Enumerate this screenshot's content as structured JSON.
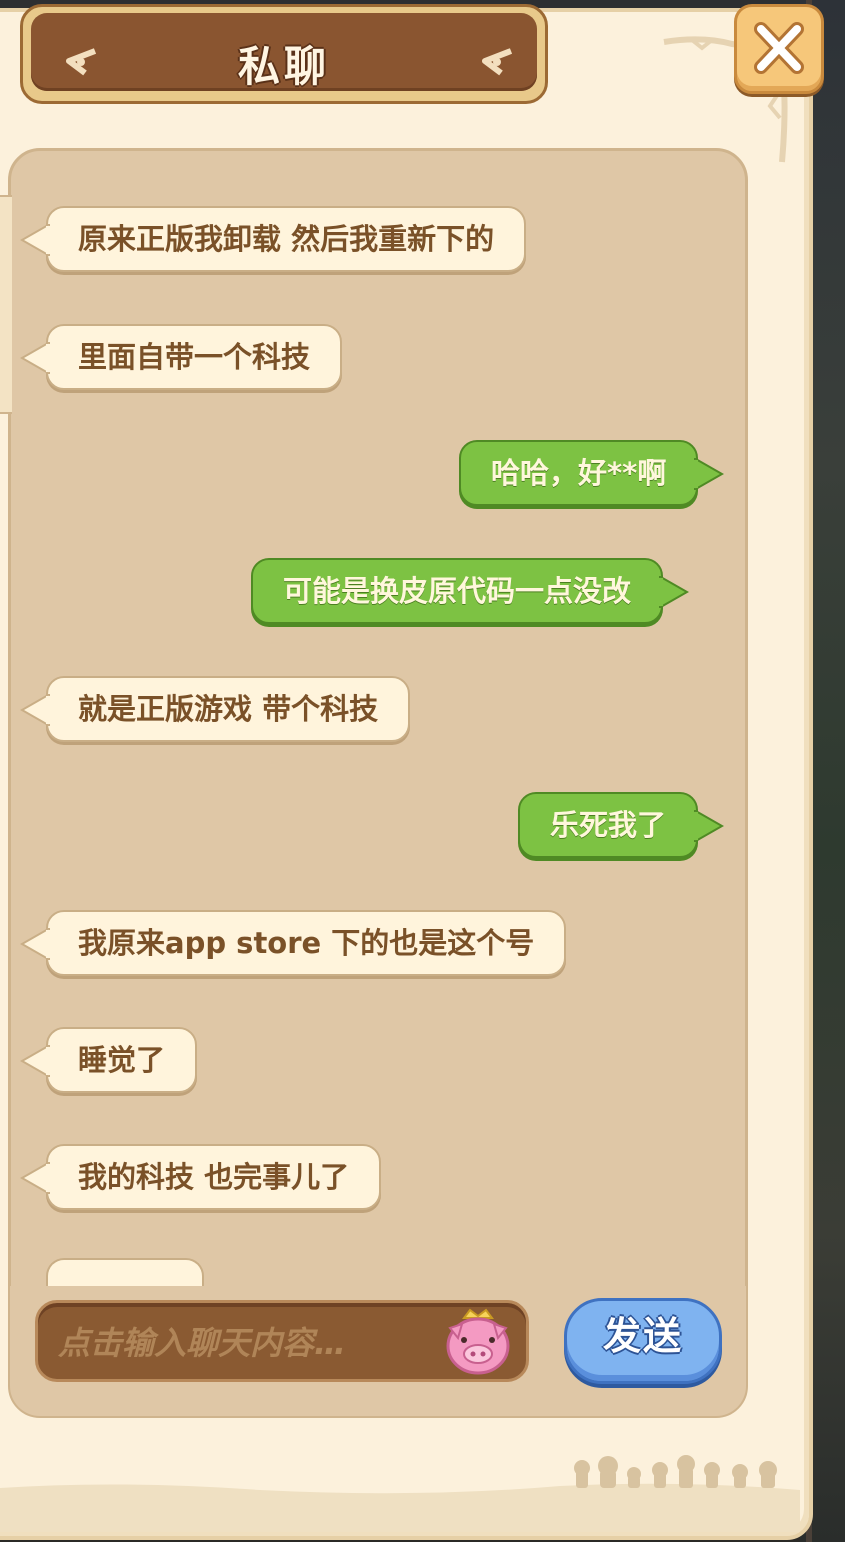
{
  "header": {
    "title": "私聊"
  },
  "close_icon": "close-icon",
  "messages": [
    {
      "side": "in",
      "text": "原来正版我卸载 然后我重新下的"
    },
    {
      "side": "in",
      "text": "里面自带一个科技"
    },
    {
      "side": "out",
      "text": "哈哈，好**啊"
    },
    {
      "side": "out",
      "text": "可能是换皮原代码一点没改"
    },
    {
      "side": "in",
      "text": "就是正版游戏 带个科技"
    },
    {
      "side": "out",
      "text": "乐死我了"
    },
    {
      "side": "in",
      "text": "我原来app store 下的也是这个号"
    },
    {
      "side": "in",
      "text": "睡觉了"
    },
    {
      "side": "in",
      "text": "我的科技 也完事儿了"
    }
  ],
  "composer": {
    "placeholder": "点击输入聊天内容…",
    "emoji_icon": "pig-emoji-icon",
    "send_label": "发送"
  },
  "colors": {
    "incoming_bubble": "#fff4dc",
    "outgoing_bubble": "#7dc243",
    "panel": "#fcf1dc",
    "chat_area": "#dfc7a6",
    "title_plate": "#8a5530",
    "send_button": "#7fb3f0"
  }
}
